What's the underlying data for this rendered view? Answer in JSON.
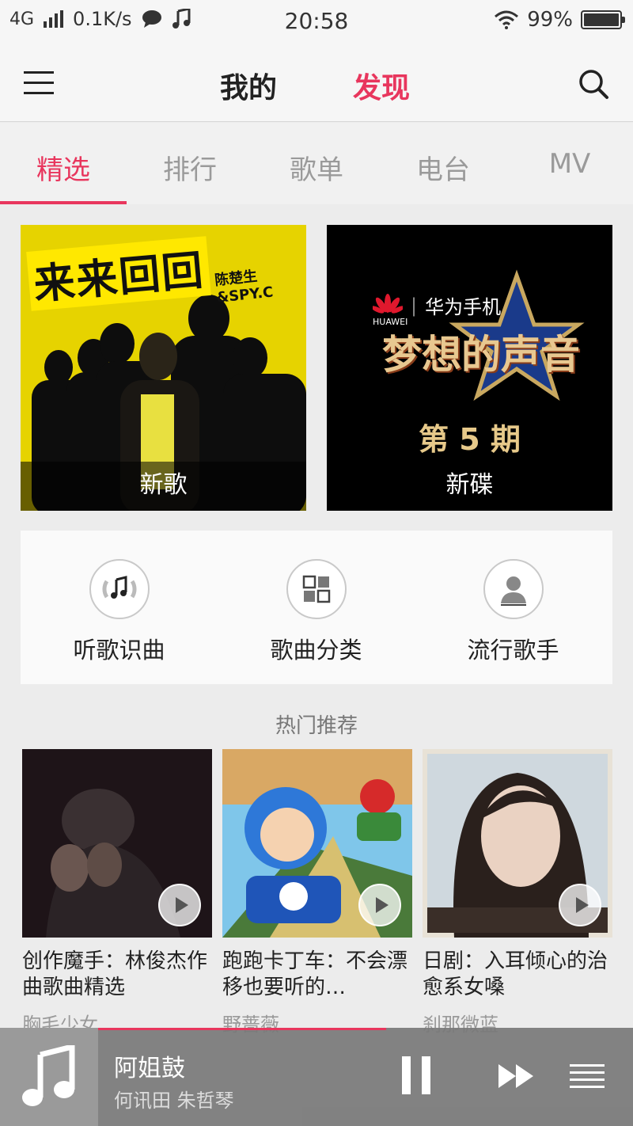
{
  "status_bar": {
    "network": "4G",
    "speed": "0.1K/s",
    "time": "20:58",
    "battery_percent": "99%",
    "battery_level": 0.99
  },
  "header": {
    "tabs": [
      {
        "label": "我的",
        "active": false
      },
      {
        "label": "发现",
        "active": true
      }
    ]
  },
  "subtabs": [
    "精选",
    "排行",
    "歌单",
    "电台",
    "MV"
  ],
  "banners": [
    {
      "caption": "新歌",
      "art_title": "来来回回",
      "art_artist": "陈楚生&SPY.C"
    },
    {
      "caption": "新碟",
      "art_brand": "华为手机",
      "art_brand_small": "HUAWEI",
      "art_show": "梦想的声音",
      "art_episode": "第 5 期"
    }
  ],
  "quick_entries": [
    {
      "label": "听歌识曲",
      "icon": "music-recognition-icon"
    },
    {
      "label": "歌曲分类",
      "icon": "category-grid-icon"
    },
    {
      "label": "流行歌手",
      "icon": "singer-person-icon"
    }
  ],
  "hot_section": {
    "title": "热门推荐",
    "cards": [
      {
        "title": "创作魔手：林俊杰作曲歌曲精选",
        "sub": "胸毛少女"
      },
      {
        "title": "跑跑卡丁车：不会漂移也要听的…",
        "sub": "野蔷薇"
      },
      {
        "title": "日剧：入耳倾心的治愈系女嗓",
        "sub": "刹那微蓝"
      }
    ]
  },
  "player": {
    "song": "阿姐鼓",
    "artist": "何讯田 朱哲琴",
    "progress": 0.61
  },
  "colors": {
    "accent": "#e8365d",
    "banner1_bg": "#e6d300"
  }
}
